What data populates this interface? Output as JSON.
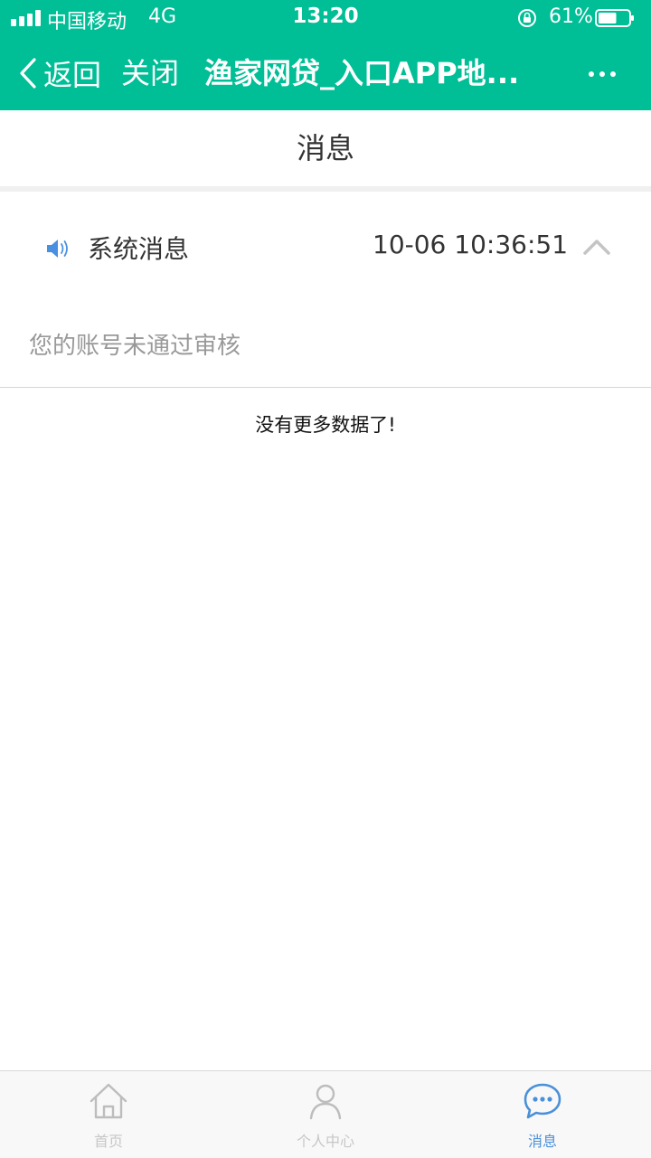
{
  "status_bar": {
    "carrier": "中国移动",
    "network": "4G",
    "time": "13:20",
    "battery_percent": "61%",
    "battery_level": 0.61
  },
  "nav": {
    "back_label": "返回",
    "close_label": "关闭",
    "title": "渔家网贷_入口APP地..."
  },
  "section": {
    "title": "消息"
  },
  "message": {
    "title": "系统消息",
    "time": "10-06 10:36:51",
    "body": "您的账号未通过审核"
  },
  "list_footer": "没有更多数据了!",
  "tabs": [
    {
      "label": "首页",
      "icon": "home-icon",
      "active": false
    },
    {
      "label": "个人中心",
      "icon": "person-icon",
      "active": false
    },
    {
      "label": "消息",
      "icon": "chat-bubble-icon",
      "active": true
    }
  ],
  "colors": {
    "header": "#00be96",
    "active_tab": "#4a90d9",
    "inactive_tab": "#c7c7c7"
  }
}
